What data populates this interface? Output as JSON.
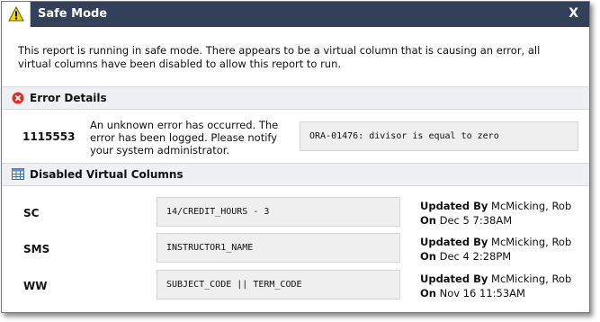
{
  "dialog": {
    "title": "Safe Mode",
    "close_label": "X"
  },
  "intro": "This report is running in safe mode. There appears to be a virtual column that is causing an error, all virtual columns have been disabled to allow this report to run.",
  "error_section": {
    "heading": "Error Details",
    "code": "1115553",
    "message": "An unknown error has occurred. The error has been logged. Please notify your system administrator.",
    "detail": "ORA-01476: divisor is equal to zero"
  },
  "disabled_section": {
    "heading": "Disabled Virtual Columns",
    "updated_by_label": "Updated By",
    "on_label": "On",
    "columns": [
      {
        "name": "SC",
        "expression": "14/CREDIT_HOURS - 3",
        "updated_by": "McMicking, Rob",
        "on": "Dec 5 7:38AM"
      },
      {
        "name": "SMS",
        "expression": "INSTRUCTOR1_NAME",
        "updated_by": "McMicking, Rob",
        "on": "Dec 4 2:28PM"
      },
      {
        "name": "WW",
        "expression": "SUBJECT_CODE || TERM_CODE",
        "updated_by": "McMicking, Rob",
        "on": "Nov 16 11:53AM"
      }
    ]
  },
  "colors": {
    "titlebar": "#34405a",
    "section_bg": "#eef0f3",
    "error_icon": "#d9302a",
    "warning_icon": "#f5d400"
  },
  "icons": {
    "title": "warning-icon",
    "error": "error-icon",
    "disabled": "grid-table-icon"
  }
}
